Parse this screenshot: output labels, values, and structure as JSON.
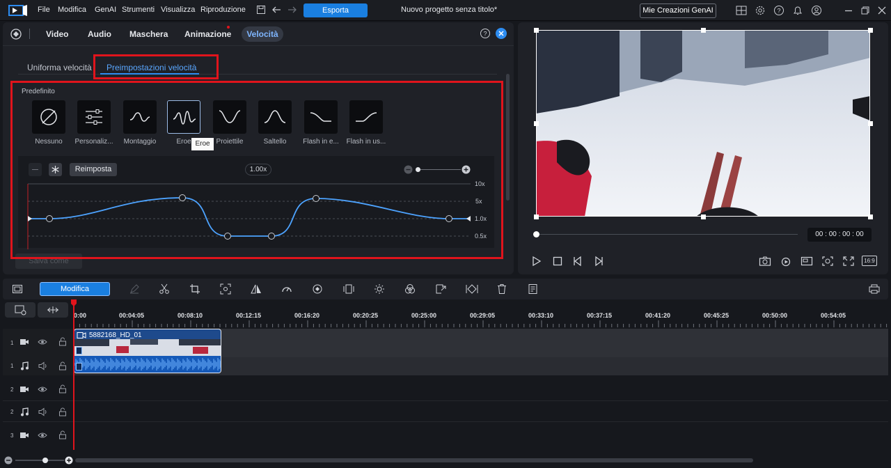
{
  "menu": [
    "File",
    "Modifica",
    "GenAI",
    "Strumenti",
    "Visualizza",
    "Riproduzione"
  ],
  "export_label": "Esporta",
  "project_title": "Nuovo progetto senza titolo*",
  "my_creations": "Mie Creazioni GenAI",
  "tabs": [
    "Video",
    "Audio",
    "Maschera",
    "Animazione",
    "Velocità"
  ],
  "subtabs": [
    "Uniforma velocità",
    "Preimpostazioni velocità"
  ],
  "section_label": "Predefinito",
  "presets": [
    "Nessuno",
    "Personaliz...",
    "Montaggio",
    "Eroe",
    "Proiettile",
    "Saltello",
    "Flash in e...",
    "Flash in us..."
  ],
  "tooltip": "Eroe",
  "reset_label": "Reimposta",
  "speed_value": "1.00x",
  "y_ticks": [
    "10x",
    "5x",
    "1.0x",
    "0.5x"
  ],
  "save_label": "Salva come",
  "timecode": "00 : 00 : 00 : 00",
  "aspect": "16:9",
  "modifica_label": "Modifica",
  "ruler": [
    "0:00",
    "00:04:05",
    "00:08:10",
    "00:12:15",
    "00:16:20",
    "00:20:25",
    "00:25:00",
    "00:29:05",
    "00:33:10",
    "00:37:15",
    "00:41:20",
    "00:45:25",
    "00:50:00",
    "00:54:05"
  ],
  "tracks": [
    "1",
    "1",
    "2",
    "2",
    "3"
  ],
  "clip_name": "5882168_HD_01",
  "colors": {
    "accent": "#1a7fe0",
    "highlight": "#e0141c",
    "curve": "#4da3ff"
  }
}
